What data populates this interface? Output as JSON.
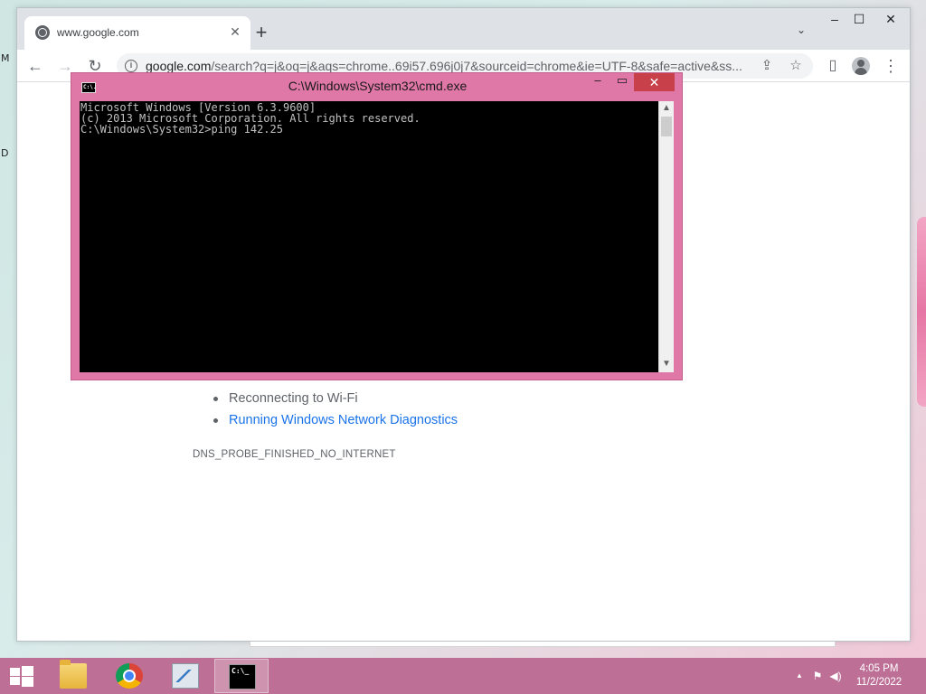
{
  "chrome": {
    "tab_title": "www.google.com",
    "tab_close": "✕",
    "new_tab": "+",
    "tab_search": "⌄",
    "window_controls": {
      "minimize": "–",
      "maximize": "☐",
      "close": "✕"
    },
    "toolbar": {
      "back": "←",
      "forward": "→",
      "reload": "↻"
    },
    "url_host": "google.com",
    "url_path": "/search?q=j&oq=j&aqs=chrome..69i57.696j0j7&sourceid=chrome&ie=UTF-8&safe=active&ss...",
    "share": "⇪",
    "bookmark": "☆",
    "side_panel": "▯",
    "menu": "⋮"
  },
  "page": {
    "bullets": [
      {
        "text": "Reconnecting to Wi-Fi",
        "link": false
      },
      {
        "text": "Running Windows Network Diagnostics",
        "link": true
      }
    ],
    "error_code": "DNS_PROBE_FINISHED_NO_INTERNET"
  },
  "cmd": {
    "icon_text": "C:\\.",
    "title": "C:\\Windows\\System32\\cmd.exe",
    "minimize": "–",
    "maximize": "▭",
    "close": "✕",
    "console_lines": [
      "Microsoft Windows [Version 6.3.9600]",
      "(c) 2013 Microsoft Corporation. All rights reserved.",
      "C:\\Windows\\System32>ping 142.25"
    ],
    "scroll_up": "▲",
    "scroll_down": "▼"
  },
  "desktop": {
    "edge_labels": [
      "M",
      "D"
    ]
  },
  "taskbar": {
    "cmd_icon_text": "C:\\_",
    "tray_chevron": "▲",
    "tray_network": "⚑",
    "tray_volume": "◀)",
    "time": "4:05 PM",
    "date": "11/2/2022"
  }
}
